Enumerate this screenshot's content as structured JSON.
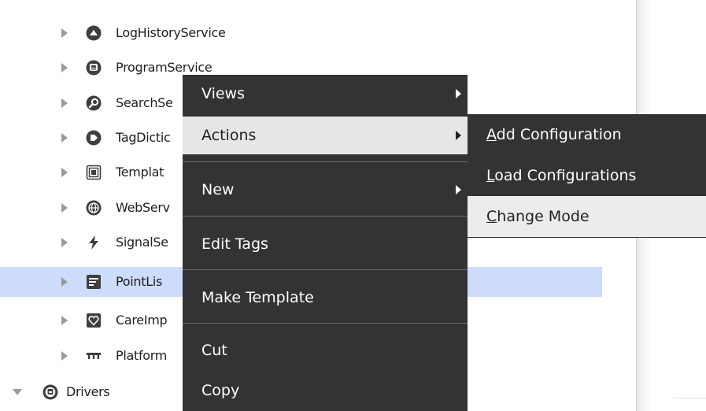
{
  "tree": {
    "items": [
      {
        "label": "LogHistoryService",
        "icon": "log-history-icon"
      },
      {
        "label": "ProgramService",
        "icon": "program-service-icon"
      },
      {
        "label": "SearchSe",
        "icon": "search-service-icon"
      },
      {
        "label": "TagDictic",
        "icon": "tag-dictionary-icon"
      },
      {
        "label": "Templat",
        "icon": "template-service-icon"
      },
      {
        "label": "WebServ",
        "icon": "web-service-icon"
      },
      {
        "label": "SignalSe",
        "icon": "signal-service-icon"
      },
      {
        "label": "PointLis",
        "icon": "point-list-icon",
        "selected": true
      },
      {
        "label": "CareImp",
        "icon": "care-import-icon"
      },
      {
        "label": "Platform",
        "icon": "platform-icon"
      },
      {
        "label": "Drivers",
        "icon": "drivers-icon",
        "expanded": true
      }
    ]
  },
  "context_menu": {
    "items": [
      {
        "label": "Views",
        "has_submenu": true
      },
      {
        "label": "Actions",
        "has_submenu": true,
        "active": true
      },
      {
        "label": "New",
        "has_submenu": true
      },
      {
        "label": "Edit Tags"
      },
      {
        "label": "Make Template"
      },
      {
        "label": "Cut"
      },
      {
        "label": "Copy"
      }
    ]
  },
  "actions_submenu": {
    "items": [
      {
        "mnemonic": "A",
        "rest": "dd Configuration"
      },
      {
        "mnemonic": "L",
        "rest": "oad Configurations"
      },
      {
        "mnemonic": "C",
        "rest": "hange Mode",
        "active": true
      }
    ]
  },
  "colors": {
    "menu_background": "#333333",
    "menu_highlight": "#e6e6e6",
    "selection_background": "#cddcfa",
    "icon_fill": "#3f3f3f"
  }
}
